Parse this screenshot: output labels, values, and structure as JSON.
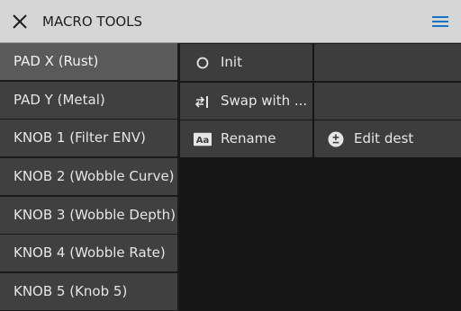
{
  "header": {
    "title": "MACRO TOOLS",
    "close_icon": "close-icon",
    "menu_icon": "hamburger-menu-icon",
    "menu_color": "#1a73c8"
  },
  "sidebar": {
    "items": [
      {
        "label": "PAD X (Rust)",
        "active": true
      },
      {
        "label": "PAD Y (Metal)",
        "active": false
      },
      {
        "label": "KNOB 1 (Filter ENV)",
        "active": false
      },
      {
        "label": "KNOB 2 (Wobble Curve)",
        "active": false
      },
      {
        "label": "KNOB 3 (Wobble Depth)",
        "active": false
      },
      {
        "label": "KNOB 4 (Wobble Rate)",
        "active": false
      },
      {
        "label": "KNOB 5 (Knob 5)",
        "active": false
      }
    ]
  },
  "actions": {
    "init": {
      "label": "Init",
      "icon": "circle-icon"
    },
    "swap": {
      "label": "Swap with ...",
      "icon": "swap-icon"
    },
    "rename": {
      "label": "Rename",
      "icon": "rename-aa-icon"
    },
    "edit_dest": {
      "label": "Edit dest",
      "icon": "plus-minus-icon"
    }
  }
}
